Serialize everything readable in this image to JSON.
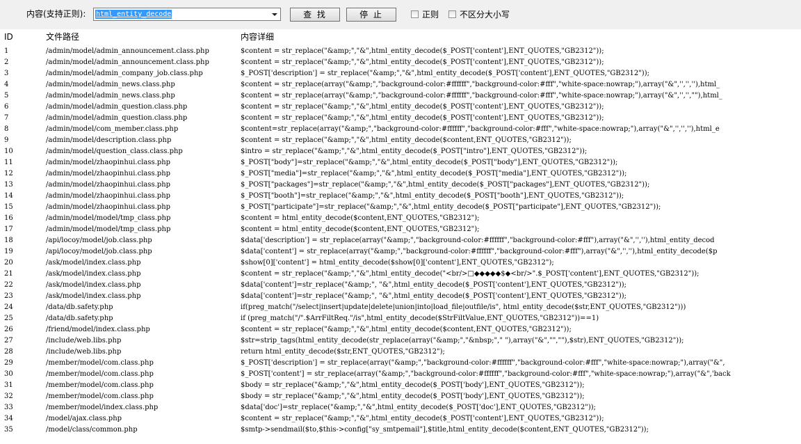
{
  "toolbar": {
    "search_label": "内容(支持正则):",
    "search_value": "html_entity_decode",
    "find_button": "查 找",
    "stop_button": "停 止",
    "regex_label": "正则",
    "case_label": "不区分大小写"
  },
  "table": {
    "headers": [
      "ID",
      "文件路径",
      "内容详细"
    ],
    "rows": [
      {
        "id": "1",
        "path": "/admin/model/admin_announcement.class.php",
        "detail": "$content = str_replace(\"&amp;\",\"&\",html_entity_decode($_POST['content'],ENT_QUOTES,\"GB2312\"));"
      },
      {
        "id": "2",
        "path": "/admin/model/admin_announcement.class.php",
        "detail": "$content = str_replace(\"&amp;\",\"&\",html_entity_decode($_POST['content'],ENT_QUOTES,\"GB2312\"));"
      },
      {
        "id": "3",
        "path": "/admin/model/admin_company_job.class.php",
        "detail": "$_POST['description'] = str_replace(\"&amp;\",\"&\",html_entity_decode($_POST['content'],ENT_QUOTES,\"GB2312\"));"
      },
      {
        "id": "4",
        "path": "/admin/model/admin_news.class.php",
        "detail": "$content = str_replace(array(\"&amp;\",\"background-color:#ffffff\",\"background-color:#fff\",\"white-space:nowrap;\"),array(\"&\",'','',''),html_"
      },
      {
        "id": "5",
        "path": "/admin/model/admin_news.class.php",
        "detail": "$content = str_replace(array(\"&amp;\",\"background-color:#ffffff\",\"background-color:#fff\",\"white-space:nowrap;\"),array(\"&\",'','',\"\"),html_"
      },
      {
        "id": "6",
        "path": "/admin/model/admin_question.class.php",
        "detail": "$content = str_replace(\"&amp;\",\"&\",html_entity_decode($_POST['content'],ENT_QUOTES,\"GB2312\"));"
      },
      {
        "id": "7",
        "path": "/admin/model/admin_question.class.php",
        "detail": "$content = str_replace(\"&amp;\",\"&\",html_entity_decode($_POST['content'],ENT_QUOTES,\"GB2312\"));"
      },
      {
        "id": "8",
        "path": "/admin/model/com_member.class.php",
        "detail": "$content=str_replace(array(\"&amp;\",\"background-color:#ffffff\",\"background-color:#fff\",\"white-space:nowrap;\"),array(\"&\",'','',''),html_e"
      },
      {
        "id": "9",
        "path": "/admin/model/description.class.php",
        "detail": "$content = str_replace(\"&amp;\",\"&\",html_entity_decode($content,ENT_QUOTES,\"GB2312\"));"
      },
      {
        "id": "10",
        "path": "/admin/model/question_class.class.php",
        "detail": "$intro = str_replace(\"&amp;\",\"&\",html_entity_decode($_POST[\"intro\"],ENT_QUOTES,\"GB2312\"));"
      },
      {
        "id": "11",
        "path": "/admin/model/zhaopinhui.class.php",
        "detail": "$_POST[\"body\"]=str_replace(\"&amp;\",\"&\",html_entity_decode($_POST[\"body\"],ENT_QUOTES,\"GB2312\"));"
      },
      {
        "id": "12",
        "path": "/admin/model/zhaopinhui.class.php",
        "detail": "$_POST[\"media\"]=str_replace(\"&amp;\",\"&\",html_entity_decode($_POST[\"media\"],ENT_QUOTES,\"GB2312\"));"
      },
      {
        "id": "13",
        "path": "/admin/model/zhaopinhui.class.php",
        "detail": "$_POST[\"packages\"]=str_replace(\"&amp;\",\"&\",html_entity_decode($_POST[\"packages\"],ENT_QUOTES,\"GB2312\"));"
      },
      {
        "id": "14",
        "path": "/admin/model/zhaopinhui.class.php",
        "detail": "$_POST[\"booth\"]=str_replace(\"&amp;\",\"&\",html_entity_decode($_POST[\"booth\"],ENT_QUOTES,\"GB2312\"));"
      },
      {
        "id": "15",
        "path": "/admin/model/zhaopinhui.class.php",
        "detail": "$_POST[\"participate\"]=str_replace(\"&amp;\",\"&\",html_entity_decode($_POST[\"participate\"],ENT_QUOTES,\"GB2312\"));"
      },
      {
        "id": "16",
        "path": "/admin/model/model/tmp_class.php",
        "detail": "$content = html_entity_decode($content,ENT_QUOTES,\"GB2312\");"
      },
      {
        "id": "17",
        "path": "/admin/model/model/tmp_class.php",
        "detail": "$content = html_entity_decode($content,ENT_QUOTES,\"GB2312\");"
      },
      {
        "id": "18",
        "path": "/api/locoy/model/job.class.php",
        "detail": "$data['description'] = str_replace(array(\"&amp;\",\"background-color:#ffffff\",\"background-color:#fff\"),array(\"&\",'',''),html_entity_decod"
      },
      {
        "id": "19",
        "path": "/api/locoy/model/job.class.php",
        "detail": "$data['content'] = str_replace(array(\"&amp;\",\"background-color:#ffffff\",\"background-color:#fff\"),array(\"&\",'',''),html_entity_decode($p"
      },
      {
        "id": "20",
        "path": "/ask/model/index.class.php",
        "detail": "$show[0]['content'] = html_entity_decode($show[0]['content'],ENT_QUOTES,\"GB2312\");"
      },
      {
        "id": "21",
        "path": "/ask/model/index.class.php",
        "detail": "$content = str_replace(\"&amp;\",\"&\",html_entity_decode(\"<br/>□◆◆◆◆◆$◆<br/>\".$_POST['content'],ENT_QUOTES,\"GB2312\"));"
      },
      {
        "id": "22",
        "path": "/ask/model/index.class.php",
        "detail": "$data['content']=str_replace(\"&amp;\", \"&\",html_entity_decode($_POST['content'],ENT_QUOTES,\"GB2312\"));"
      },
      {
        "id": "23",
        "path": "/ask/model/index.class.php",
        "detail": "$data['content']=str_replace(\"&amp;\", \"&\",html_entity_decode($_POST['content'],ENT_QUOTES,\"GB2312\"));"
      },
      {
        "id": "24",
        "path": "/data/db.safety.php",
        "detail": "if(preg_match(\"/select|insert|update|delete|union|into|load_file|outfile/is\", html_entity_decode($str,ENT_QUOTES,\"GB2312\")))"
      },
      {
        "id": "25",
        "path": "/data/db.safety.php",
        "detail": "if (preg_match(\"/\".$ArrFiltReq.\"/is\",html_entity_decode($StrFiltValue,ENT_QUOTES,\"GB2312\"))==1)"
      },
      {
        "id": "26",
        "path": "/friend/model/index.class.php",
        "detail": "$content = str_replace(\"&amp;\",\"&\",html_entity_decode($content,ENT_QUOTES,\"GB2312\"));"
      },
      {
        "id": "27",
        "path": "/include/web.libs.php",
        "detail": "$str=strip_tags(html_entity_decode(str_replace(array(\"&amp;\",\"&nbsp;\",\" \"),array(\"&\",\"\",\"\"),$str),ENT_QUOTES,\"GB2312\"));"
      },
      {
        "id": "28",
        "path": "/include/web.libs.php",
        "detail": "return html_entity_decode($str,ENT_QUOTES,\"GB2312\");"
      },
      {
        "id": "29",
        "path": "/member/model/com.class.php",
        "detail": "$_POST['description'] = str_replace(array(\"&amp;\",\"background-color:#ffffff\",\"background-color:#fff\",\"white-space:nowrap;\"),array(\"&\","
      },
      {
        "id": "30",
        "path": "/member/model/com.class.php",
        "detail": "$_POST['content'] = str_replace(array(\"&amp;\",\"background-color:#ffffff\",\"background-color:#fff\",\"white-space:nowrap;\"),array(\"&\",'back"
      },
      {
        "id": "31",
        "path": "/member/model/com.class.php",
        "detail": "$body = str_replace(\"&amp;\",\"&\",html_entity_decode($_POST['body'],ENT_QUOTES,\"GB2312\"));"
      },
      {
        "id": "32",
        "path": "/member/model/com.class.php",
        "detail": "$body = str_replace(\"&amp;\",\"&\",html_entity_decode($_POST['body'],ENT_QUOTES,\"GB2312\"));"
      },
      {
        "id": "33",
        "path": "/member/model/index.class.php",
        "detail": "$data['doc']=str_replace(\"&amp;\",\"&\",html_entity_decode($_POST['doc'],ENT_QUOTES,\"GB2312\"));"
      },
      {
        "id": "34",
        "path": "/model/ajax.class.php",
        "detail": "$content = str_replace(\"&amp;\",\"&\",html_entity_decode($_POST['content'],ENT_QUOTES,\"GB2312\"));"
      },
      {
        "id": "35",
        "path": "/model/class/common.php",
        "detail": "$smtp->sendmail($to,$this->config[\"sy_smtpemail\"],$title,html_entity_decode($content,ENT_QUOTES,\"GB2312\"));"
      }
    ]
  }
}
